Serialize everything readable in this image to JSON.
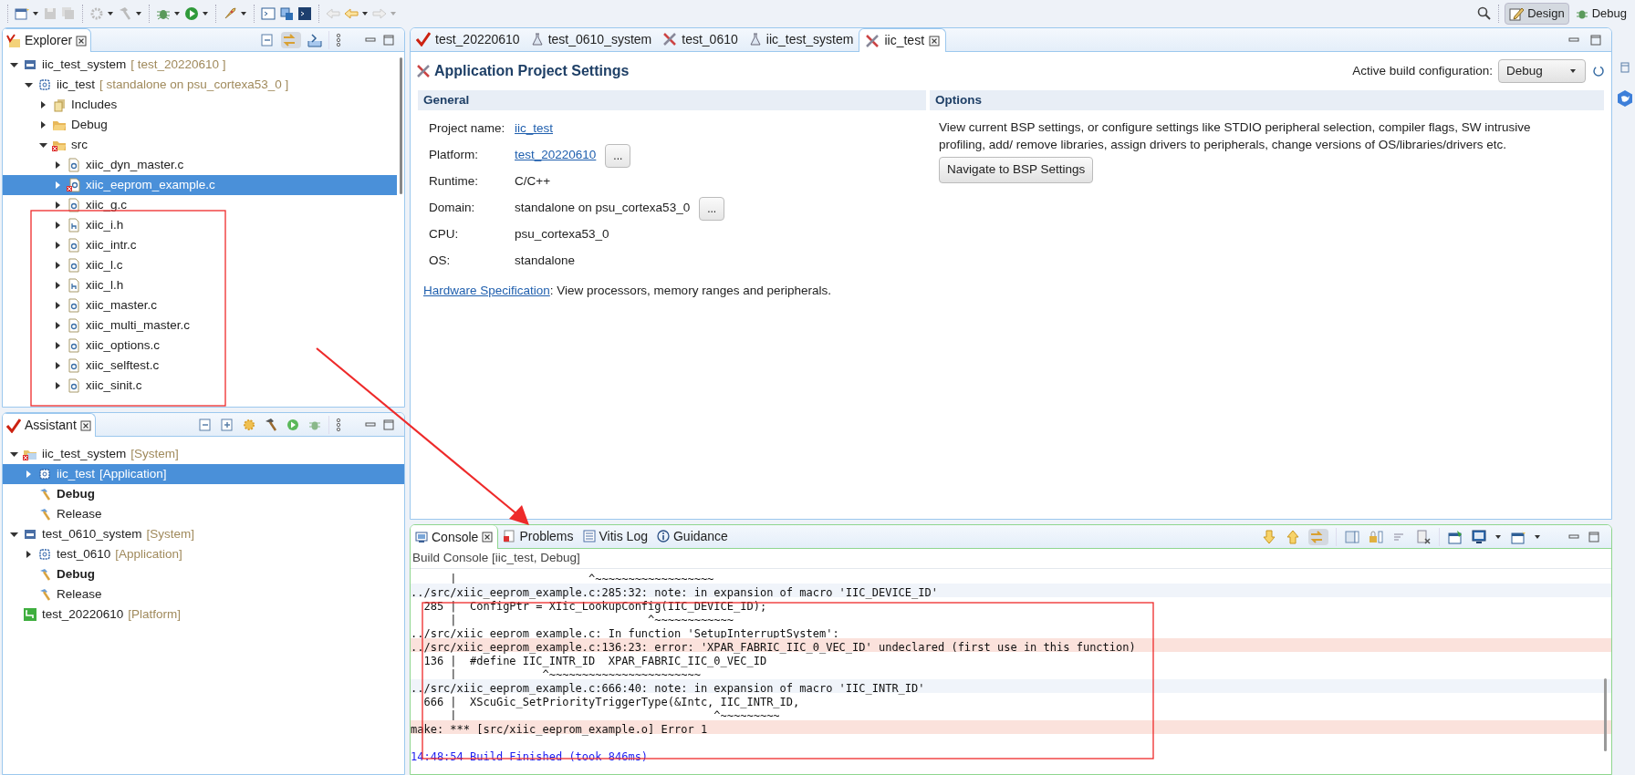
{
  "toolbar": {
    "perspectives": [
      {
        "label": "Design",
        "selected": true
      },
      {
        "label": "Debug",
        "selected": false
      }
    ]
  },
  "explorer": {
    "title": "Explorer",
    "tree": [
      {
        "label": "iic_test_system",
        "decoration": "[ test_20220610 ]",
        "kind": "system",
        "expanded": true,
        "selected": false,
        "children": [
          {
            "label": "iic_test",
            "decoration": "[ standalone on psu_cortexa53_0 ]",
            "kind": "app",
            "expanded": true,
            "selected": false,
            "children": [
              {
                "label": "Includes",
                "kind": "includes",
                "expanded": false,
                "selected": false
              },
              {
                "label": "Debug",
                "kind": "folder",
                "expanded": false,
                "selected": false
              },
              {
                "label": "src",
                "kind": "folder-error",
                "expanded": true,
                "selected": false,
                "children": [
                  {
                    "label": "xiic_dyn_master.c",
                    "kind": "c",
                    "expanded": false,
                    "selected": false
                  },
                  {
                    "label": "xiic_eeprom_example.c",
                    "kind": "c-error",
                    "expanded": false,
                    "selected": true
                  },
                  {
                    "label": "xiic_g.c",
                    "kind": "c",
                    "expanded": false,
                    "selected": false
                  },
                  {
                    "label": "xiic_i.h",
                    "kind": "h",
                    "expanded": false,
                    "selected": false
                  },
                  {
                    "label": "xiic_intr.c",
                    "kind": "c",
                    "expanded": false,
                    "selected": false
                  },
                  {
                    "label": "xiic_l.c",
                    "kind": "c",
                    "expanded": false,
                    "selected": false
                  },
                  {
                    "label": "xiic_l.h",
                    "kind": "h",
                    "expanded": false,
                    "selected": false
                  },
                  {
                    "label": "xiic_master.c",
                    "kind": "c",
                    "expanded": false,
                    "selected": false
                  },
                  {
                    "label": "xiic_multi_master.c",
                    "kind": "c",
                    "expanded": false,
                    "selected": false
                  },
                  {
                    "label": "xiic_options.c",
                    "kind": "c",
                    "expanded": false,
                    "selected": false
                  },
                  {
                    "label": "xiic_selftest.c",
                    "kind": "c",
                    "expanded": false,
                    "selected": false
                  },
                  {
                    "label": "xiic_sinit.c",
                    "kind": "c",
                    "expanded": false,
                    "selected": false
                  }
                ]
              }
            ]
          }
        ]
      }
    ]
  },
  "assistant": {
    "title": "Assistant",
    "tree": [
      {
        "label": "iic_test_system",
        "decoration": "[System]",
        "kind": "system-error",
        "expanded": true,
        "selected": false,
        "children": [
          {
            "label": "iic_test",
            "decoration": "[Application]",
            "kind": "app",
            "expanded": false,
            "selected": true
          },
          {
            "label": "Debug",
            "kind": "config",
            "active": true,
            "selected": false
          },
          {
            "label": "Release",
            "kind": "config",
            "active": false,
            "selected": false
          }
        ]
      },
      {
        "label": "test_0610_system",
        "decoration": "[System]",
        "kind": "system",
        "expanded": true,
        "selected": false,
        "children": [
          {
            "label": "test_0610",
            "decoration": "[Application]",
            "kind": "app",
            "expanded": false,
            "selected": false
          },
          {
            "label": "Debug",
            "kind": "config",
            "active": true,
            "selected": false
          },
          {
            "label": "Release",
            "kind": "config",
            "active": false,
            "selected": false
          }
        ]
      },
      {
        "label": "test_20220610",
        "decoration": "[Platform]",
        "kind": "platform",
        "selected": false
      }
    ]
  },
  "editor": {
    "tabs": [
      {
        "label": "test_20220610",
        "kind": "platform",
        "selected": false
      },
      {
        "label": "test_0610_system",
        "kind": "system",
        "selected": false
      },
      {
        "label": "test_0610",
        "kind": "app",
        "selected": false
      },
      {
        "label": "iic_test_system",
        "kind": "system",
        "selected": false
      },
      {
        "label": "iic_test",
        "kind": "app",
        "selected": true
      }
    ],
    "title": "Application Project Settings",
    "build_config_label": "Active build configuration:",
    "build_config": "Debug",
    "general": {
      "heading": "General",
      "rows": [
        {
          "label": "Project name:",
          "value": "iic_test",
          "kind": "link"
        },
        {
          "label": "Platform:",
          "value": "test_20220610",
          "kind": "link",
          "button": "..."
        },
        {
          "label": "Runtime:",
          "value": "C/C++",
          "kind": "text"
        },
        {
          "label": "Domain:",
          "value": "standalone on psu_cortexa53_0",
          "kind": "text",
          "button": "..."
        },
        {
          "label": "CPU:",
          "value": "psu_cortexa53_0",
          "kind": "text"
        },
        {
          "label": "OS:",
          "value": "standalone",
          "kind": "text"
        }
      ],
      "hardware_link": "Hardware Specification",
      "hardware_text": ": View processors, memory ranges and peripherals."
    },
    "options": {
      "heading": "Options",
      "description": "View current BSP settings, or configure settings like STDIO peripheral selection, compiler flags, SW intrusive profiling, add/ remove libraries, assign drivers to peripherals, change versions of OS/libraries/drivers etc.",
      "button": "Navigate to BSP Settings"
    }
  },
  "console": {
    "tabs": [
      {
        "label": "Console",
        "kind": "console",
        "selected": true
      },
      {
        "label": "Problems",
        "kind": "problems",
        "selected": false
      },
      {
        "label": "Vitis Log",
        "kind": "log",
        "selected": false
      },
      {
        "label": "Guidance",
        "kind": "info",
        "selected": false
      }
    ],
    "title": "Build Console [iic_test, Debug]",
    "lines": [
      {
        "text": "      |                    ^~~~~~~~~~~~~~~~~~~",
        "kind": "plain"
      },
      {
        "text": "../src/xiic_eeprom_example.c:285:32: note: in expansion of macro 'IIC_DEVICE_ID'",
        "kind": "note"
      },
      {
        "text": "  285 |  ConfigPtr = XIic_LookupConfig(IIC_DEVICE_ID);",
        "kind": "plain"
      },
      {
        "text": "      |                             ^~~~~~~~~~~~~",
        "kind": "plain"
      },
      {
        "text": "../src/xiic_eeprom_example.c: In function 'SetupInterruptSystem':",
        "kind": "plain"
      },
      {
        "text": "../src/xiic_eeprom_example.c:136:23: error: 'XPAR_FABRIC_IIC_0_VEC_ID' undeclared (first use in this function)",
        "kind": "error"
      },
      {
        "text": "  136 |  #define IIC_INTR_ID  XPAR_FABRIC_IIC_0_VEC_ID",
        "kind": "plain"
      },
      {
        "text": "      |             ^~~~~~~~~~~~~~~~~~~~~~~~",
        "kind": "plain"
      },
      {
        "text": "../src/xiic_eeprom_example.c:666:40: note: in expansion of macro 'IIC_INTR_ID'",
        "kind": "note"
      },
      {
        "text": "  666 |  XScuGic_SetPriorityTriggerType(&Intc, IIC_INTR_ID,",
        "kind": "plain"
      },
      {
        "text": "      |                                       ^~~~~~~~~~",
        "kind": "plain"
      },
      {
        "text": "make: *** [src/xiic_eeprom_example.o] Error 1",
        "kind": "error"
      },
      {
        "kind": "blank"
      },
      {
        "text": "14:48:54 Build Finished (took 846ms)",
        "kind": "info"
      }
    ]
  },
  "annotations": [
    {
      "kind": "box"
    },
    {
      "kind": "box"
    },
    {
      "kind": "arrow"
    }
  ]
}
